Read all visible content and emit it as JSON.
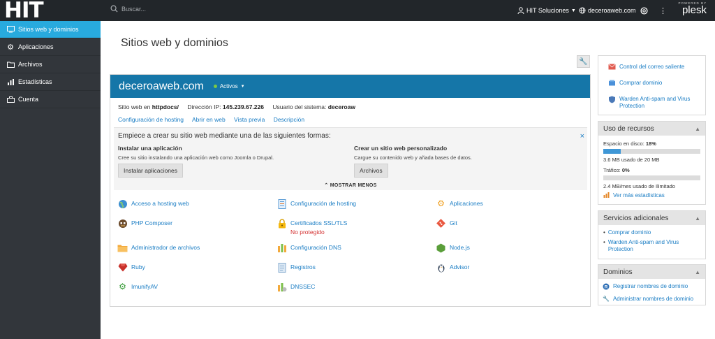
{
  "app": {
    "logo": "HIT",
    "powered_by": "POWERED BY",
    "brand": "plesk"
  },
  "search": {
    "placeholder": "Buscar..."
  },
  "topbar": {
    "user": "HIT Soluciones",
    "domain": "deceroaweb.com"
  },
  "sidebar": {
    "items": [
      {
        "label": "Sitios web y dominios",
        "icon": "monitor-icon",
        "active": true
      },
      {
        "label": "Aplicaciones",
        "icon": "gear-icon"
      },
      {
        "label": "Archivos",
        "icon": "folder-icon"
      },
      {
        "label": "Estadísticas",
        "icon": "bar-chart-icon"
      },
      {
        "label": "Cuenta",
        "icon": "briefcase-icon"
      }
    ]
  },
  "main": {
    "title": "Sitios web y dominios",
    "domain": {
      "name": "deceroaweb.com",
      "status": "Activos",
      "site_label": "Sitio web en",
      "site_path": "httpdocs/",
      "ip_label": "Dirección IP:",
      "ip": "145.239.67.226",
      "user_label": "Usuario del sistema:",
      "user": "deceroaw",
      "links": [
        "Configuración de hosting",
        "Abrir en web",
        "Vista previa",
        "Descripción"
      ]
    },
    "start": {
      "title": "Empiece a crear su sitio web mediante una de las siguientes formas:",
      "close": "×",
      "option1": {
        "heading": "Instalar una aplicación",
        "desc": "Cree su sitio instalando una aplicación web como Joomla o Drupal.",
        "button": "Instalar aplicaciones"
      },
      "option2": {
        "heading": "Crear un sitio web personalizado",
        "desc": "Cargue su contenido web y añada bases de datos.",
        "button": "Archivos"
      },
      "toggle": "MOSTRAR MENOS"
    },
    "tools": [
      {
        "label": "Acceso a hosting web",
        "icon": "globe-icon"
      },
      {
        "label": "Configuración de hosting",
        "icon": "document-icon"
      },
      {
        "label": "Aplicaciones",
        "icon": "gear-icon"
      },
      {
        "label": "PHP Composer",
        "icon": "composer-icon"
      },
      {
        "label": "Certificados SSL/TLS",
        "icon": "lock-icon",
        "warning": "No protegido"
      },
      {
        "label": "Git",
        "icon": "git-icon"
      },
      {
        "label": "Administrador de archivos",
        "icon": "folder-icon"
      },
      {
        "label": "Configuración DNS",
        "icon": "dns-icon"
      },
      {
        "label": "Node.js",
        "icon": "nodejs-icon"
      },
      {
        "label": "Ruby",
        "icon": "ruby-icon"
      },
      {
        "label": "Registros",
        "icon": "logs-icon"
      },
      {
        "label": "Advisor",
        "icon": "penguin-icon"
      },
      {
        "label": "ImunifyAV",
        "icon": "shield-gear-icon"
      },
      {
        "label": "DNSSEC",
        "icon": "dnssec-icon"
      }
    ]
  },
  "right": {
    "quick": [
      {
        "label": "Control del correo saliente",
        "icon": "mail-icon"
      },
      {
        "label": "Comprar dominio",
        "icon": "cart-icon"
      },
      {
        "label": "Warden Anti-spam and Virus Protection",
        "icon": "warden-icon"
      }
    ],
    "resources": {
      "title": "Uso de recursos",
      "disk_label": "Espacio en disco:",
      "disk_pct": "18%",
      "disk_fraction": 0.18,
      "disk_text": "3.6 MB usado de 20 MB",
      "traffic_label": "Tráfico:",
      "traffic_pct": "0%",
      "traffic_fraction": 0.0,
      "traffic_text": "2.4 MB/mes usado de Ilimitado",
      "more": "Ver más estadísticas"
    },
    "services": {
      "title": "Servicios adicionales",
      "items": [
        "Comprar dominio",
        "Warden Anti-spam and Virus Protection"
      ]
    },
    "domains": {
      "title": "Dominios",
      "items": [
        {
          "label": "Registrar nombres de dominio",
          "icon": "register-icon"
        },
        {
          "label": "Administrar nombres de dominio",
          "icon": "wrench-icon"
        }
      ]
    }
  },
  "colors": {
    "accent": "#28aade",
    "header_blue": "#1576a8",
    "link": "#1a7dc4",
    "sidebar": "#32363b",
    "topbar": "#22262a"
  }
}
